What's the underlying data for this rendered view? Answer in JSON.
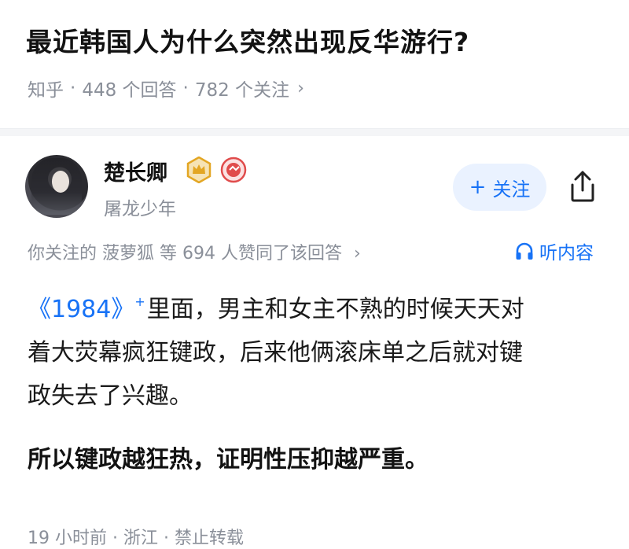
{
  "question": {
    "title": "最近韩国人为什么突然出现反华游行?",
    "source": "知乎",
    "dot": "·",
    "answers": "448 个回答",
    "followers": "782 个关注",
    "chevron": "›"
  },
  "author": {
    "name": "楚长卿",
    "bio": "屠龙少年",
    "follow_label": "关注",
    "follow_plus": "+",
    "badge_crown_icon": "crown-badge-icon",
    "badge_red_icon": "red-medal-icon",
    "share_icon": "share-icon"
  },
  "likers": {
    "text": "你关注的 菠萝狐 等 694 人赞同了该回答",
    "chevron": "›"
  },
  "listen": {
    "label": "听内容",
    "icon": "headphones-icon"
  },
  "answer": {
    "book": "《1984》",
    "sup": "+",
    "line1_rest": "里面，男主和女主不熟的时候天天对",
    "line2": "着大荧幕疯狂键政，后来他俩滚床单之后就对键",
    "line3": "政失去了兴趣。",
    "bold_line": "所以键政越狂热，证明性压抑越严重。"
  },
  "footer": {
    "time": "19 小时前",
    "dot": "·",
    "region": "浙江",
    "copyright": "禁止转载"
  },
  "colors": {
    "accent": "#1772f6",
    "muted": "#8a8f99",
    "follow_bg": "#eaf2ff",
    "crown": "#e3a623",
    "medal": "#e04b4b"
  }
}
